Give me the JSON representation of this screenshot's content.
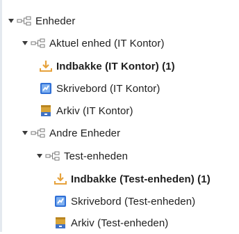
{
  "tree": {
    "root": {
      "label": "Enheder",
      "icon": "org-tree-icon"
    },
    "current_unit": {
      "label": "Aktuel enhed (IT Kontor)",
      "icon": "org-tree-icon",
      "items": [
        {
          "label": "Indbakke (IT Kontor) (1)",
          "icon": "inbox-tray-icon",
          "bold": true
        },
        {
          "label": "Skrivebord (IT Kontor)",
          "icon": "desktop-icon",
          "bold": false
        },
        {
          "label": "Arkiv (IT Kontor)",
          "icon": "archive-icon",
          "bold": false
        }
      ]
    },
    "other_units": {
      "label": "Andre Enheder",
      "icon": "org-tree-icon",
      "child": {
        "label": "Test-enheden",
        "icon": "org-tree-icon",
        "items": [
          {
            "label": "Indbakke (Test-enheden) (1)",
            "icon": "inbox-tray-icon",
            "bold": true
          },
          {
            "label": "Skrivebord (Test-enheden)",
            "icon": "desktop-icon",
            "bold": false
          },
          {
            "label": "Arkiv (Test-enheden)",
            "icon": "archive-icon",
            "bold": false
          }
        ]
      }
    }
  },
  "colors": {
    "arrow": "#3a3a3a",
    "inbox_orange": "#e6a23c",
    "desktop_blue": "#2f6fd6",
    "archive_gold": "#d8a438",
    "archive_blue": "#3f72c6"
  }
}
